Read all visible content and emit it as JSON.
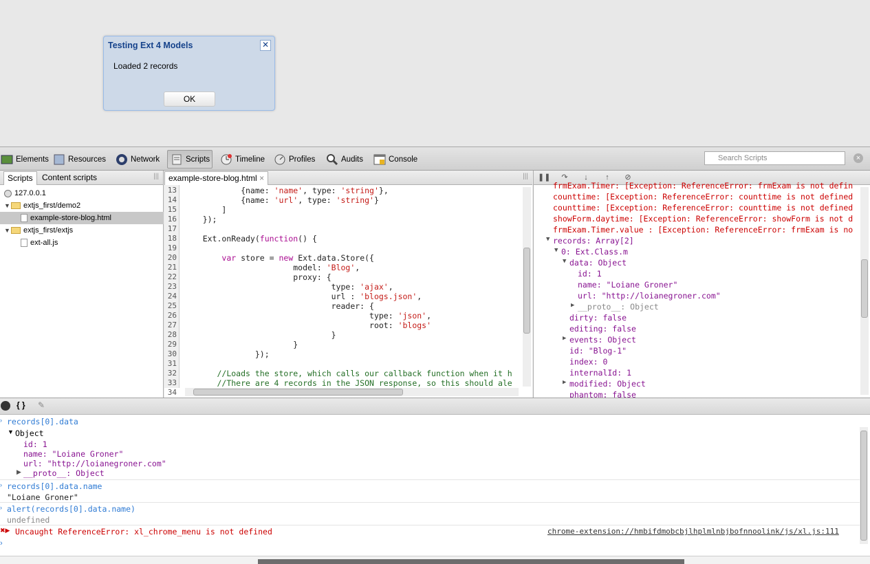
{
  "dialog": {
    "title": "Testing Ext 4 Models",
    "message": "Loaded 2 records",
    "ok_label": "OK",
    "close_glyph": "✕"
  },
  "toolbar": {
    "items": [
      {
        "label": "Elements",
        "icon": "elements-icon"
      },
      {
        "label": "Resources",
        "icon": "resources-icon"
      },
      {
        "label": "Network",
        "icon": "network-icon"
      },
      {
        "label": "Scripts",
        "icon": "scripts-icon"
      },
      {
        "label": "Timeline",
        "icon": "timeline-icon"
      },
      {
        "label": "Profiles",
        "icon": "profiles-icon"
      },
      {
        "label": "Audits",
        "icon": "audits-icon"
      },
      {
        "label": "Console",
        "icon": "console-icon"
      }
    ],
    "selected": "Scripts",
    "search_placeholder": "Search Scripts"
  },
  "sidebar": {
    "tabs": [
      "Scripts",
      "Content scripts"
    ],
    "tree": [
      {
        "label": "127.0.0.1"
      },
      {
        "label": "extjs_first/demo2"
      },
      {
        "label": "example-store-blog.html",
        "selected": true
      },
      {
        "label": "extjs_first/extjs"
      },
      {
        "label": "ext-all.js"
      }
    ]
  },
  "source": {
    "file_tab": "example-store-blog.html",
    "tab_close": "×",
    "line_numbers": [
      "13",
      "14",
      "15",
      "16",
      "17",
      "18",
      "19",
      "20",
      "21",
      "22",
      "23",
      "24",
      "25",
      "26",
      "27",
      "28",
      "29",
      "30",
      "31",
      "32",
      "33",
      "34"
    ]
  },
  "watch": {
    "lines": [
      "frmExam.Timer: [Exception: ReferenceError: frmExam is not defin",
      "counttime: [Exception: ReferenceError: counttime is not defined",
      "counttime: [Exception: ReferenceError: counttime is not defined",
      "showForm.daytime: [Exception: ReferenceError: showForm is not d",
      "frmExam.Timer.value : [Exception: ReferenceError: frmExam is no",
      "records: Array[2]",
      "0: Ext.Class.m",
      "data: Object",
      "id: 1",
      "name: \"Loiane Groner\"",
      "url: \"http://loianegroner.com\"",
      "__proto__: Object",
      "dirty: false",
      "editing: false",
      "events: Object",
      "id: \"Blog-1\"",
      "index: 0",
      "internalId: 1",
      "modified: Object",
      "phantom: false"
    ]
  },
  "console": {
    "braces": "{ }",
    "lines": [
      "records[0].data",
      "Object",
      "id: 1",
      "name: \"Loiane Groner\"",
      "url: \"http://loianegroner.com\"",
      "__proto__: Object",
      "records[0].data.name",
      "\"Loiane Groner\"",
      "alert(records[0].data.name)",
      "undefined",
      "Uncaught ReferenceError: xl_chrome_menu is not defined"
    ],
    "error_link": "chrome-extension://hmbifdmobcbjlhplmlnbjbofnnoolink/js/xl.js:111"
  }
}
